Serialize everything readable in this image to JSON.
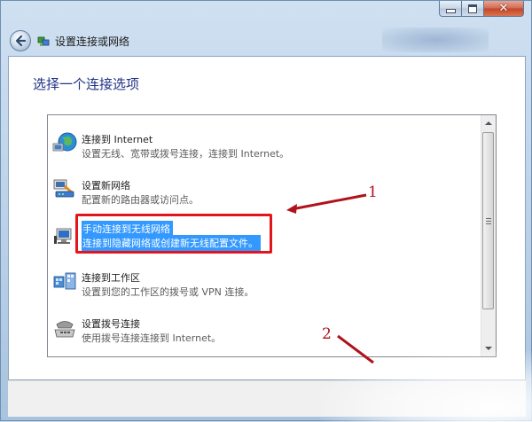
{
  "window": {
    "title": "设置连接或网络",
    "close_glyph": "✕"
  },
  "page": {
    "heading": "选择一个连接选项"
  },
  "options": [
    {
      "title": "连接到 Internet",
      "desc": "设置无线、宽带或拨号连接，连接到 Internet。",
      "icon": "globe-network-icon"
    },
    {
      "title": "设置新网络",
      "desc": "配置新的路由器或访问点。",
      "icon": "router-icon"
    },
    {
      "title": "手动连接到无线网络",
      "desc": "连接到隐藏网络或创建新无线配置文件。",
      "icon": "wireless-computer-icon",
      "selected": true
    },
    {
      "title": "连接到工作区",
      "desc": "设置到您的工作区的拨号或 VPN 连接。",
      "icon": "workplace-icon"
    },
    {
      "title": "设置拨号连接",
      "desc": "使用拨号连接连接到 Internet。",
      "icon": "dialup-phone-icon"
    }
  ],
  "annotations": {
    "label1": "1",
    "label2": "2",
    "color": "#b0121b"
  },
  "colors": {
    "heading": "#1e3287",
    "selection": "#3399ff",
    "highlight_border": "#e2141c"
  }
}
